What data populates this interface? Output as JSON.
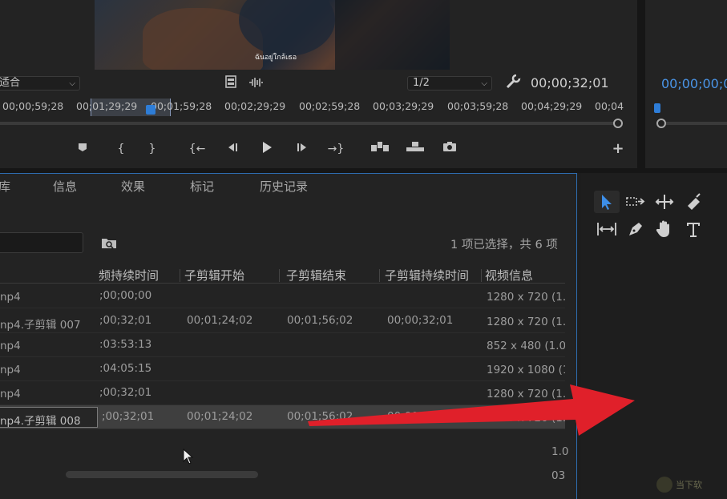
{
  "source_monitor": {
    "subtitle": "ฉันอยู่ใกล้เธอ",
    "fit_select": "适合",
    "resolution_select": "1/2",
    "timecode": "00;00;32;01",
    "ruler_labels": [
      "00;00;59;28",
      "00;01;29;29",
      "00;01;59;28",
      "00;02;29;29",
      "00;02;59;28",
      "00;03;29;29",
      "00;03;59;28",
      "00;04;29;29",
      "00;04"
    ],
    "transport": {
      "add_marker": "⬟",
      "mark_in": "{",
      "mark_out": "}",
      "go_to_in": "{←",
      "step_back": "◀|",
      "play": "▶",
      "step_forward": "|▶",
      "go_to_out": "→}",
      "insert": "insert",
      "overwrite": "overwrite",
      "export_frame": "camera",
      "add": "+"
    }
  },
  "program_monitor": {
    "timecode": "00;00;00;0"
  },
  "project_panel": {
    "tabs": [
      "库",
      "信息",
      "效果",
      "标记",
      "历史记录"
    ],
    "selection_status": "1 项已选择，共 6 项",
    "columns": [
      "频持续时间",
      "子剪辑开始",
      "子剪辑结束",
      "子剪辑持续时间",
      "视频信息"
    ],
    "rows": [
      {
        "name": "np4",
        "duration": ";00;00;00",
        "sub_start": "",
        "sub_end": "",
        "sub_duration": "",
        "video_info": "1280 x 720 (1.0"
      },
      {
        "name": "np4.子剪辑 007",
        "duration": ";00;32;01",
        "sub_start": "00;01;24;02",
        "sub_end": "00;01;56;02",
        "sub_duration": "00;00;32;01",
        "video_info": "1280 x 720 (1.0"
      },
      {
        "name": "np4",
        "duration": ":03:53:13",
        "sub_start": "",
        "sub_end": "",
        "sub_duration": "",
        "video_info": "852 x 480 (1.03"
      },
      {
        "name": "np4",
        "duration": ":04:05:15",
        "sub_start": "",
        "sub_end": "",
        "sub_duration": "",
        "video_info": "1920 x 1080 (1."
      },
      {
        "name": "np4",
        "duration": ";00;32;01",
        "sub_start": "",
        "sub_end": "",
        "sub_duration": "",
        "video_info": "1280 x 720 (1.0"
      },
      {
        "name": "np4.子剪辑 008",
        "duration": ";00;32;01",
        "sub_start": "00;01;24;02",
        "sub_end": "00;01;56;02",
        "sub_duration": "00;00;32;01",
        "video_info": "1280 x 720 (1.0"
      }
    ],
    "stray_values": [
      "1.0",
      "03"
    ]
  },
  "tools": [
    "selection-tool",
    "track-select-tool",
    "ripple-edit-tool",
    "razor-tool",
    "slip-tool",
    "pen-tool",
    "hand-tool",
    "type-tool"
  ],
  "watermark": "当下软",
  "colors": {
    "accent": "#2e7dd7",
    "panel_border": "#2e6cb0",
    "annotation_arrow": "#e0202a"
  }
}
